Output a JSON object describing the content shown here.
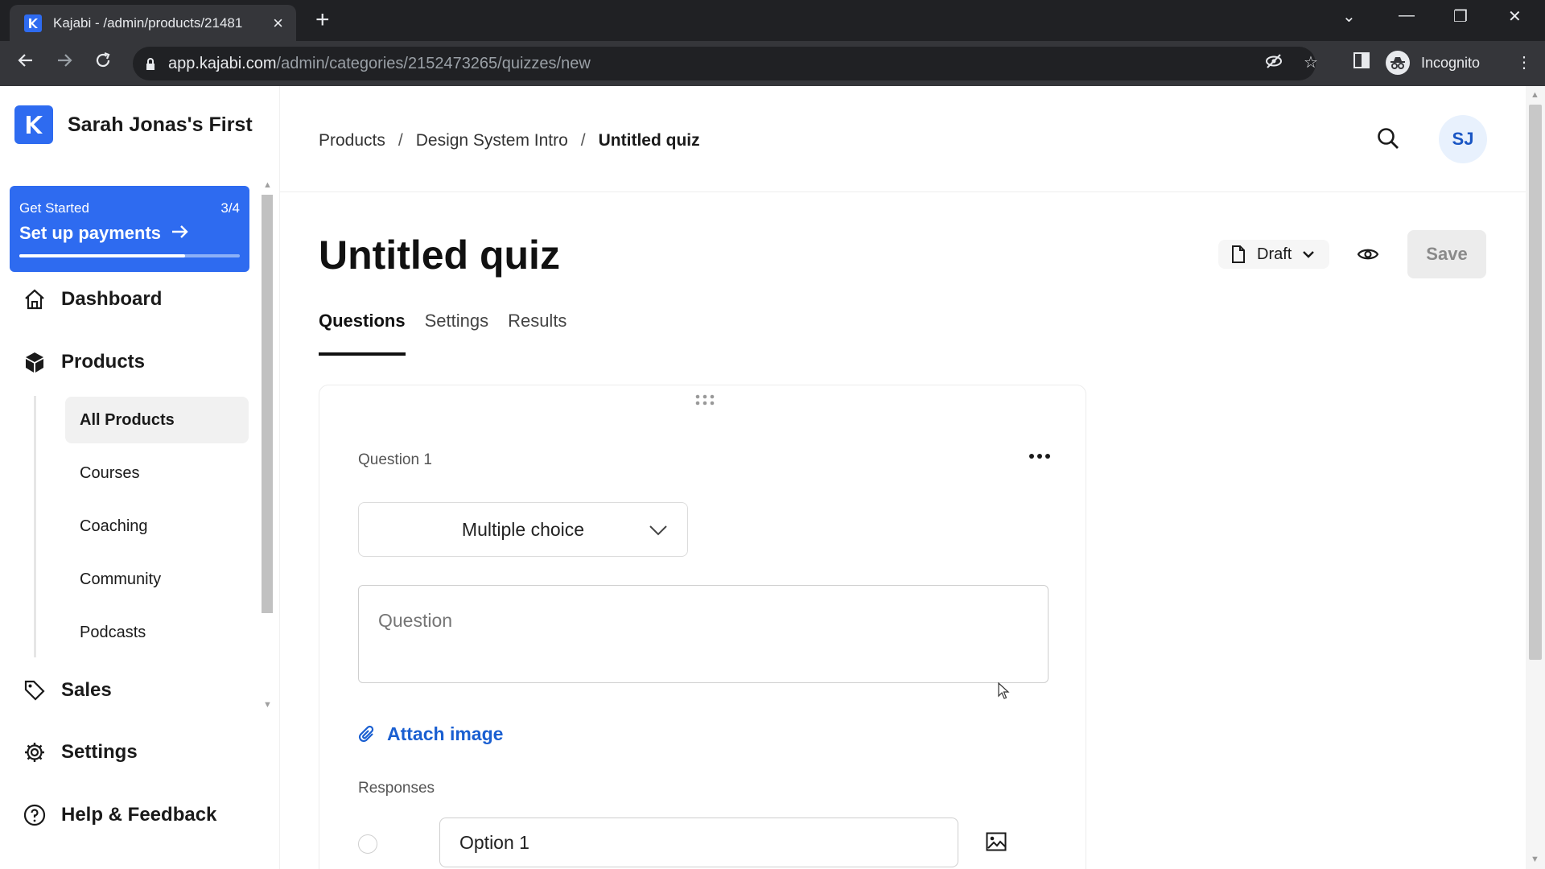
{
  "browser": {
    "tab_title": "Kajabi - /admin/products/21481",
    "url_domain": "app.kajabi.com",
    "url_path": "/admin/categories/2152473265/quizzes/new",
    "profile_label": "Incognito"
  },
  "sidebar": {
    "brand_name": "Sarah Jonas's First",
    "get_started": {
      "label": "Get Started",
      "progress": "3/4",
      "progress_fraction": 0.75,
      "title": "Set up payments"
    },
    "nav": [
      {
        "label": "Dashboard",
        "icon": "home-icon"
      },
      {
        "label": "Products",
        "icon": "box-icon"
      },
      {
        "label": "Sales",
        "icon": "tag-icon"
      },
      {
        "label": "Settings",
        "icon": "gear-icon"
      },
      {
        "label": "Help & Feedback",
        "icon": "help-icon"
      }
    ],
    "products_sub": [
      "All Products",
      "Courses",
      "Coaching",
      "Community",
      "Podcasts"
    ]
  },
  "header": {
    "breadcrumb": [
      "Products",
      "Design System Intro",
      "Untitled quiz"
    ],
    "separator": "/",
    "avatar_initials": "SJ"
  },
  "page": {
    "title": "Untitled quiz",
    "status": "Draft",
    "save_label": "Save",
    "tabs": [
      "Questions",
      "Settings",
      "Results"
    ],
    "active_tab": "Questions"
  },
  "question": {
    "label": "Question 1",
    "type": "Multiple choice",
    "placeholder": "Question",
    "attach_label": "Attach image",
    "responses_label": "Responses",
    "options": [
      {
        "value": "Option 1"
      }
    ]
  },
  "colors": {
    "brand": "#2e6bf0",
    "link": "#1a5fd1",
    "avatar_bg": "#e8f1fd"
  }
}
